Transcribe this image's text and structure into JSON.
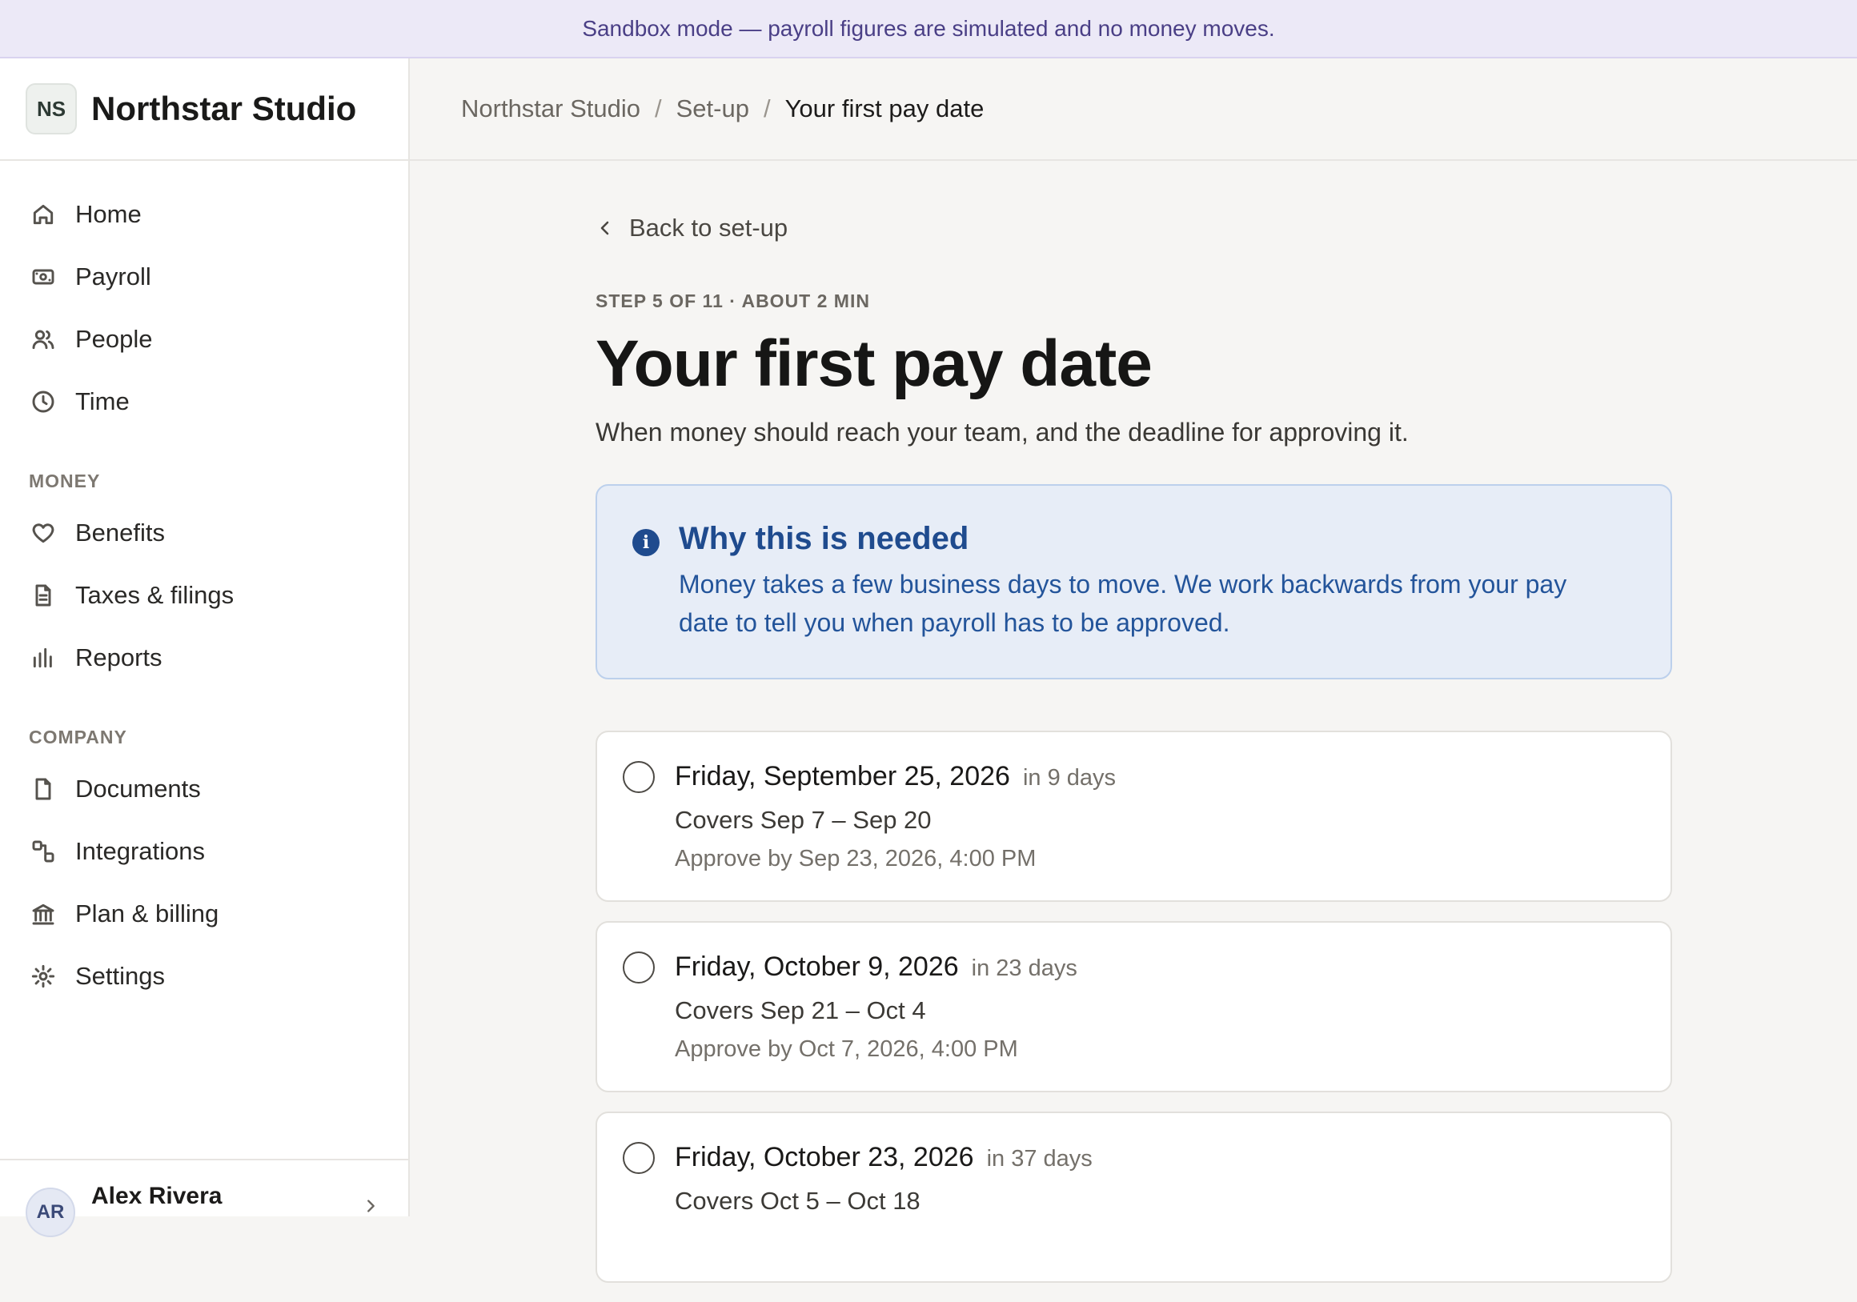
{
  "banner": {
    "text": "Sandbox mode — payroll figures are simulated and no money moves."
  },
  "sidebar": {
    "logo": "NS",
    "company": "Northstar Studio",
    "items_main": [
      {
        "label": "Home",
        "icon": "home-icon"
      },
      {
        "label": "Payroll",
        "icon": "payroll-icon"
      },
      {
        "label": "People",
        "icon": "people-icon"
      },
      {
        "label": "Time",
        "icon": "clock-icon"
      }
    ],
    "section_money": "MONEY",
    "items_money": [
      {
        "label": "Benefits",
        "icon": "heart-icon"
      },
      {
        "label": "Taxes & filings",
        "icon": "document-icon"
      },
      {
        "label": "Reports",
        "icon": "bar-chart-icon"
      }
    ],
    "section_company": "COMPANY",
    "items_company": [
      {
        "label": "Documents",
        "icon": "file-icon"
      },
      {
        "label": "Integrations",
        "icon": "integrations-icon"
      },
      {
        "label": "Plan & billing",
        "icon": "bank-icon"
      },
      {
        "label": "Settings",
        "icon": "gear-icon"
      }
    ],
    "user": {
      "initials": "AR",
      "name": "Alex Rivera"
    }
  },
  "breadcrumb": {
    "items": [
      "Northstar Studio",
      "Set-up"
    ],
    "separator": "/",
    "current": "Your first pay date"
  },
  "main": {
    "back_label": "Back to set-up",
    "step": "STEP 5 OF 11 · ABOUT 2 MIN",
    "title": "Your first pay date",
    "subtitle": "When money should reach your team, and the deadline for approving it.",
    "info": {
      "icon": "info-icon",
      "title": "Why this is needed",
      "body": "Money takes a few business days to move. We work backwards from your pay date to tell you when payroll has to be approved."
    },
    "dates": [
      {
        "date": "Friday, September 25, 2026",
        "relative": "in 9 days",
        "covers": "Covers Sep 7 – Sep 20",
        "approve": "Approve by Sep 23, 2026, 4:00 PM"
      },
      {
        "date": "Friday, October 9, 2026",
        "relative": "in 23 days",
        "covers": "Covers Sep 21 – Oct 4",
        "approve": "Approve by Oct 7, 2026, 4:00 PM"
      },
      {
        "date": "Friday, October 23, 2026",
        "relative": "in 37 days",
        "covers": "Covers Oct 5 – Oct 18",
        "approve": ""
      }
    ]
  },
  "colors": {
    "banner_bg": "#ece9f7",
    "banner_text": "#4a3f86",
    "info_bg": "#e7edf7",
    "info_accent": "#1f4b8e"
  }
}
